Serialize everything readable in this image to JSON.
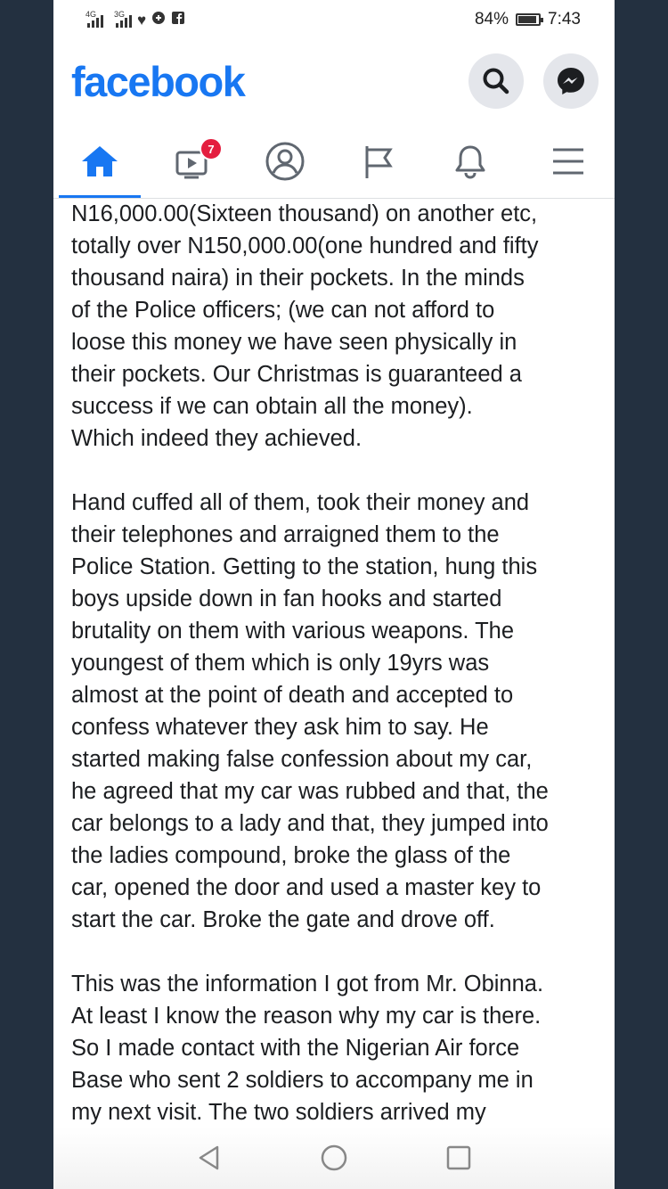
{
  "status_bar": {
    "network1": "4G",
    "network2": "3G",
    "battery": "84%",
    "time": "7:43"
  },
  "header": {
    "logo": "facebook",
    "icons": [
      "search-icon",
      "messenger-icon"
    ]
  },
  "nav": {
    "items": [
      "home-icon",
      "watch-icon",
      "profile-icon",
      "pages-icon",
      "notifications-icon",
      "menu-icon"
    ],
    "watch_badge": "7",
    "active": "home"
  },
  "post": {
    "paragraphs": [
      "N16,000.00(Sixteen thousand) on another etc,\ntotally over N150,000.00(one hundred and fifty\nthousand naira)  in their pockets. In the minds\nof the Police officers; (we can not afford to\nloose this money we have seen physically in\ntheir pockets. Our Christmas is guaranteed a\nsuccess if we can obtain all the money).\nWhich indeed they achieved.",
      "Hand cuffed all of them, took their money and\ntheir telephones and arraigned them to the\nPolice Station.  Getting to the station, hung this\nboys upside down in fan hooks and started\nbrutality on them with various weapons. The\nyoungest of them which is only 19yrs was\nalmost at the point of death and accepted to\nconfess whatever they ask him to say.  He\nstarted making false confession about my car,\nhe agreed that my car was rubbed and that, the\ncar belongs to a lady and that, they jumped into\nthe ladies compound, broke the glass of the\ncar, opened the door and used a master key to\nstart the car. Broke the gate and drove off.",
      "This was the information I got from Mr. Obinna.\nAt least I know the reason why my car is there.\nSo I made contact with the Nigerian Air force\nBase who sent 2 soldiers to accompany me in\nmy next visit. The two soldiers arrived my"
    ]
  },
  "system_nav": [
    "back-icon",
    "home-circle-icon",
    "recents-icon"
  ],
  "colors": {
    "brand": "#1877f2",
    "badge": "#e41e3f",
    "backdrop": "#233040"
  }
}
